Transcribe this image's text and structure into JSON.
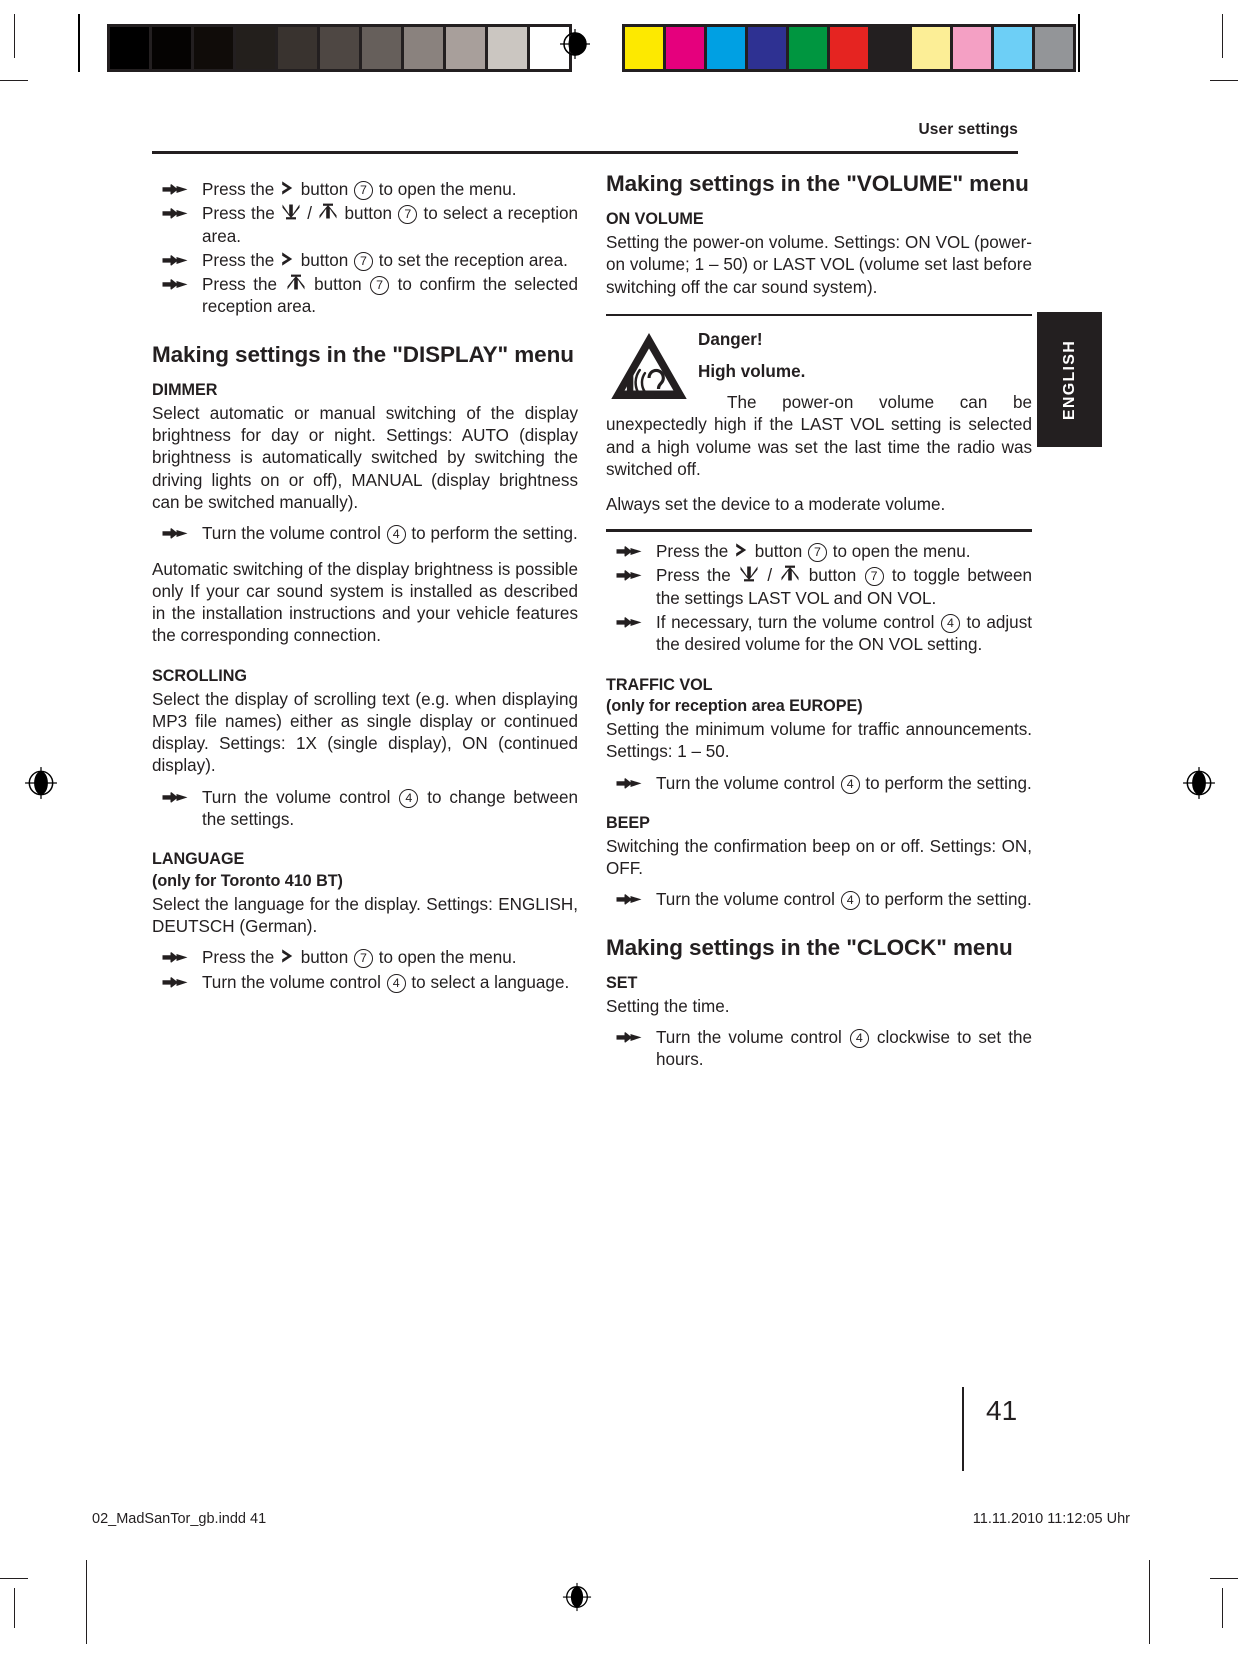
{
  "print_marks": {
    "gray_swatches": [
      "#000000",
      "#050302",
      "#100c09",
      "#231f1c",
      "#39332f",
      "#4e4743",
      "#665f5b",
      "#8a827e",
      "#a89f9b",
      "#cbc6c1",
      "#ffffff"
    ],
    "color_swatches": [
      "#fde900",
      "#e5007d",
      "#00a0e3",
      "#2e3192",
      "#009640",
      "#e52421",
      "#231f20",
      "#fcee96",
      "#f4a0c4",
      "#6dcff6",
      "#939598"
    ],
    "registration_icon": "registration-target-icon"
  },
  "header": {
    "title": "User settings",
    "language_tab": "ENGLISH"
  },
  "left_column": {
    "intro_steps": [
      {
        "id": "step-open-menu",
        "parts": [
          {
            "t": "text",
            "v": "Press the "
          },
          {
            "t": "glyph",
            "v": "arrow-right-glyph"
          },
          {
            "t": "text",
            "v": " button "
          },
          {
            "t": "knob",
            "v": "7"
          },
          {
            "t": "text",
            "v": " to open the menu."
          }
        ]
      },
      {
        "id": "step-select-reception-area",
        "parts": [
          {
            "t": "text",
            "v": "Press the "
          },
          {
            "t": "glyph",
            "v": "arrow-down-bar-glyph"
          },
          {
            "t": "text",
            "v": " / "
          },
          {
            "t": "glyph",
            "v": "arrow-up-bar-glyph"
          },
          {
            "t": "text",
            "v": " button "
          },
          {
            "t": "knob",
            "v": "7"
          },
          {
            "t": "text",
            "v": " to select a reception area."
          }
        ]
      },
      {
        "id": "step-set-reception-area",
        "parts": [
          {
            "t": "text",
            "v": "Press the "
          },
          {
            "t": "glyph",
            "v": "arrow-right-glyph"
          },
          {
            "t": "text",
            "v": " button "
          },
          {
            "t": "knob",
            "v": "7"
          },
          {
            "t": "text",
            "v": " to set the reception area."
          }
        ]
      },
      {
        "id": "step-confirm-reception-area",
        "parts": [
          {
            "t": "text",
            "v": "Press the "
          },
          {
            "t": "glyph",
            "v": "arrow-up-bar-glyph"
          },
          {
            "t": "text",
            "v": " button "
          },
          {
            "t": "knob",
            "v": "7"
          },
          {
            "t": "text",
            "v": " to confirm the selected reception area."
          }
        ]
      }
    ],
    "display_section_title": "Making settings in the \"DISPLAY\" menu",
    "dimmer": {
      "title": "DIMMER",
      "body": "Select automatic or manual switching of the display brightness for day or night. Settings: AUTO (display brightness is automatically switched by switching the driving lights on or off), MANUAL (display brightness can be switched manually).",
      "step": [
        {
          "t": "text",
          "v": "Turn the volume control "
        },
        {
          "t": "knob",
          "v": "4"
        },
        {
          "t": "text",
          "v": " to perform the setting."
        }
      ],
      "note": "Automatic switching of the display brightness is possible only If your car sound system is installed as described in the installation instructions and your vehicle features the corresponding connection."
    },
    "scrolling": {
      "title": "SCROLLING",
      "body": "Select the display of scrolling text (e.g. when displaying MP3 file names) either as single display or continued display. Settings: 1X (single display), ON (continued display).",
      "step": [
        {
          "t": "text",
          "v": "Turn the volume control "
        },
        {
          "t": "knob",
          "v": "4"
        },
        {
          "t": "text",
          "v": " to change between the settings."
        }
      ]
    },
    "language": {
      "title": "LANGUAGE",
      "subtitle": "(only for Toronto 410 BT)",
      "body": "Select the language for the display. Settings: ENGLISH, DEUTSCH (German).",
      "steps": [
        {
          "id": "step-lang-open-menu",
          "parts": [
            {
              "t": "text",
              "v": "Press the "
            },
            {
              "t": "glyph",
              "v": "arrow-right-glyph"
            },
            {
              "t": "text",
              "v": " button "
            },
            {
              "t": "knob",
              "v": "7"
            },
            {
              "t": "text",
              "v": " to open the menu."
            }
          ]
        },
        {
          "id": "step-lang-select",
          "parts": [
            {
              "t": "text",
              "v": "Turn the volume control "
            },
            {
              "t": "knob",
              "v": "4"
            },
            {
              "t": "text",
              "v": " to select a language."
            }
          ]
        }
      ]
    }
  },
  "right_column": {
    "volume_section_title": "Making settings in the \"VOLUME\" menu",
    "on_volume": {
      "title": "ON VOLUME",
      "body": "Setting the power-on volume. Settings: ON VOL (power-on volume; 1 – 50) or LAST VOL (volume set last before switching off the car sound system)."
    },
    "danger": {
      "icon": "high-volume-warning-icon",
      "heading": "Danger!",
      "subheading": "High volume.",
      "text": "The power-on volume can be unexpectedly high if the LAST VOL setting is selected and a high volume was set the last time the radio was switched off.",
      "footer": "Always set the device to a moderate volume."
    },
    "volume_steps": [
      {
        "id": "step-vol-open-menu",
        "parts": [
          {
            "t": "text",
            "v": "Press the "
          },
          {
            "t": "glyph",
            "v": "arrow-right-glyph"
          },
          {
            "t": "text",
            "v": " button "
          },
          {
            "t": "knob",
            "v": "7"
          },
          {
            "t": "text",
            "v": " to open the menu."
          }
        ]
      },
      {
        "id": "step-vol-toggle",
        "parts": [
          {
            "t": "text",
            "v": "Press the "
          },
          {
            "t": "glyph",
            "v": "arrow-down-bar-glyph"
          },
          {
            "t": "text",
            "v": " / "
          },
          {
            "t": "glyph",
            "v": "arrow-up-bar-glyph"
          },
          {
            "t": "text",
            "v": " button "
          },
          {
            "t": "knob",
            "v": "7"
          },
          {
            "t": "text",
            "v": " to toggle between the settings LAST VOL and ON VOL."
          }
        ]
      },
      {
        "id": "step-vol-adjust",
        "parts": [
          {
            "t": "text",
            "v": "If necessary, turn the volume control "
          },
          {
            "t": "knob",
            "v": "4"
          },
          {
            "t": "text",
            "v": " to adjust the desired volume for the ON VOL setting."
          }
        ]
      }
    ],
    "traffic_vol": {
      "title": "TRAFFIC VOL",
      "subtitle": "(only for reception area EUROPE)",
      "body": "Setting the minimum volume for traffic announcements. Settings: 1 – 50.",
      "step": [
        {
          "t": "text",
          "v": "Turn the volume control "
        },
        {
          "t": "knob",
          "v": "4"
        },
        {
          "t": "text",
          "v": " to perform the setting."
        }
      ]
    },
    "beep": {
      "title": "BEEP",
      "body": "Switching the confirmation beep on or off. Settings: ON, OFF.",
      "step": [
        {
          "t": "text",
          "v": "Turn the volume control "
        },
        {
          "t": "knob",
          "v": "4"
        },
        {
          "t": "text",
          "v": " to perform the setting."
        }
      ]
    },
    "clock_section_title": "Making settings in the \"CLOCK\" menu",
    "set": {
      "title": "SET",
      "body": "Setting the time.",
      "step": [
        {
          "t": "text",
          "v": "Turn the volume control "
        },
        {
          "t": "knob",
          "v": "4"
        },
        {
          "t": "text",
          "v": " clockwise to set the hours."
        }
      ]
    }
  },
  "page_number": "41",
  "footer": {
    "file": "02_MadSanTor_gb.indd   41",
    "timestamp": "11.11.2010   11:12:05 Uhr"
  }
}
